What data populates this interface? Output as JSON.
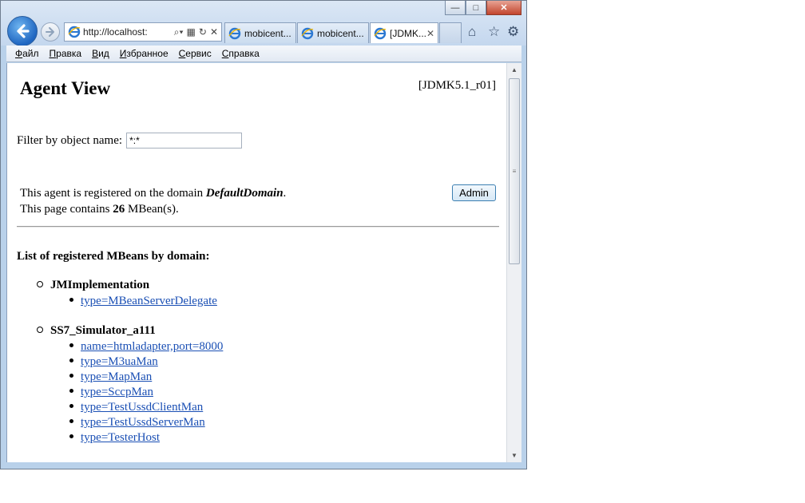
{
  "browser": {
    "address_url": "http://localhost:",
    "tabs": [
      {
        "label": "mobicent..."
      },
      {
        "label": "mobicent..."
      },
      {
        "label": "[JDMK..."
      }
    ],
    "menu": [
      "Файл",
      "Правка",
      "Вид",
      "Избранное",
      "Сервис",
      "Справка"
    ],
    "menu_underline": [
      "Ф",
      "П",
      "В",
      "И",
      "С",
      "С"
    ],
    "menu_rest": [
      "айл",
      "равка",
      "ид",
      "збранное",
      "ервис",
      "правка"
    ]
  },
  "page": {
    "title": "Agent View",
    "version": "[JDMK5.1_r01]",
    "filter_label": "Filter by object name:",
    "filter_value": "*:*",
    "registered_prefix": "This agent is registered on the domain ",
    "domain_name": "DefaultDomain",
    "registered_suffix": ".",
    "contains_prefix": "This page contains ",
    "mbean_count": "26",
    "contains_suffix": " MBean(s).",
    "admin_label": "Admin",
    "list_heading": "List of registered MBeans by domain:",
    "domains": [
      {
        "name": "JMImplementation",
        "mbeans": [
          "type=MBeanServerDelegate"
        ]
      },
      {
        "name": "SS7_Simulator_a111",
        "mbeans": [
          "name=htmladapter,port=8000",
          "type=M3uaMan",
          "type=MapMan",
          "type=SccpMan",
          "type=TestUssdClientMan",
          "type=TestUssdServerMan",
          "type=TesterHost"
        ]
      }
    ]
  },
  "colors": {
    "link": "#1a4fb4",
    "frame": "#b9d1ea"
  }
}
